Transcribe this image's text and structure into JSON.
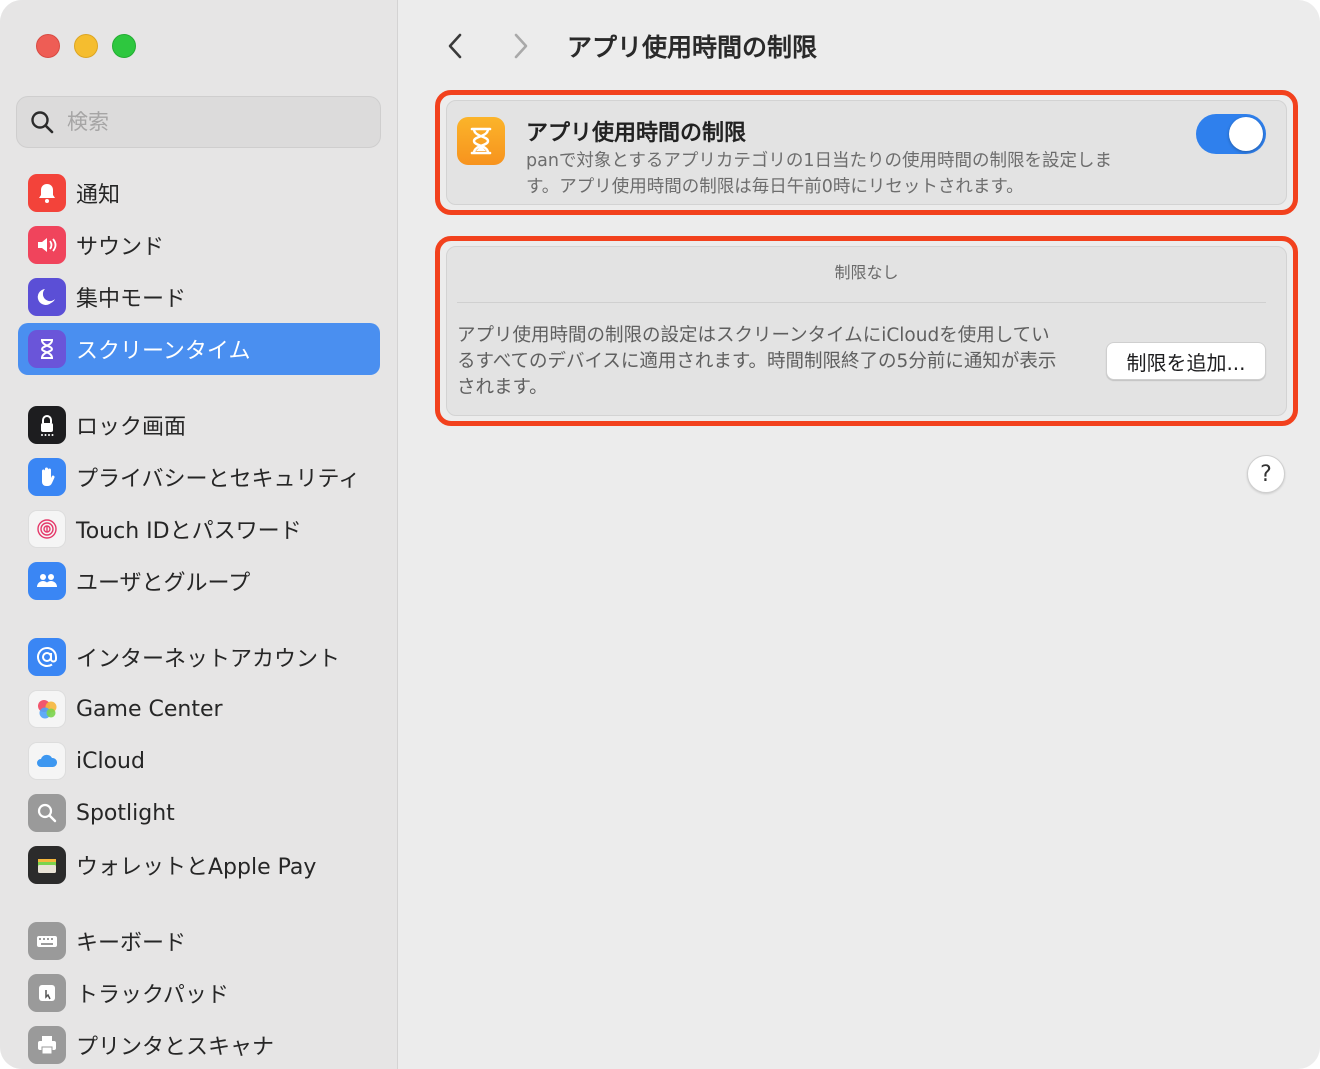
{
  "window": {
    "title": "アプリ使用時間の制限"
  },
  "search": {
    "placeholder": "検索"
  },
  "sidebar": {
    "items": [
      {
        "label": "通知",
        "icon": "bell-icon",
        "color": "#f3433a"
      },
      {
        "label": "サウンド",
        "icon": "speaker-icon",
        "color": "#f0445c"
      },
      {
        "label": "集中モード",
        "icon": "moon-icon",
        "color": "#5b4fd6"
      },
      {
        "label": "スクリーンタイム",
        "icon": "hourglass-icon",
        "color": "#6a55d9",
        "selected": true
      },
      {
        "label": "ロック画面",
        "icon": "lock-icon",
        "color": "#1d1d1f"
      },
      {
        "label": "プライバシーとセキュリティ",
        "icon": "hand-icon",
        "color": "#3a86f4"
      },
      {
        "label": "Touch IDとパスワード",
        "icon": "fingerprint-icon",
        "color": "#f5f5f5"
      },
      {
        "label": "ユーザとグループ",
        "icon": "users-icon",
        "color": "#3a86f4"
      },
      {
        "label": "インターネットアカウント",
        "icon": "at-icon",
        "color": "#3a86f4"
      },
      {
        "label": "Game Center",
        "icon": "game-center-icon",
        "color": "#f5f5f5"
      },
      {
        "label": "iCloud",
        "icon": "cloud-icon",
        "color": "#f5f5f5"
      },
      {
        "label": "Spotlight",
        "icon": "magnifier-icon",
        "color": "#9a9a9a"
      },
      {
        "label": "ウォレットとApple Pay",
        "icon": "wallet-icon",
        "color": "#2b2b2b"
      },
      {
        "label": "キーボード",
        "icon": "keyboard-icon",
        "color": "#9a9a9a"
      },
      {
        "label": "トラックパッド",
        "icon": "trackpad-icon",
        "color": "#9a9a9a"
      },
      {
        "label": "プリンタとスキャナ",
        "icon": "printer-icon",
        "color": "#9a9a9a"
      }
    ]
  },
  "limit_card": {
    "title": "アプリ使用時間の制限",
    "description": "panで対象とするアプリカテゴリの1日当たりの使用時間の制限を設定します。アプリ使用時間の制限は毎日午前0時にリセットされます。",
    "toggle_on": true,
    "icon": "hourglass-icon"
  },
  "limits_list": {
    "empty_label": "制限なし",
    "footer_text": "アプリ使用時間の制限の設定はスクリーンタイムにiCloudを使用しているすべてのデバイスに適用されます。時間制限終了の5分前に通知が表示されます。",
    "add_button": "制限を追加..."
  },
  "help_label": "?",
  "colors": {
    "accent": "#2f80ed",
    "selection": "#4a8ff0",
    "highlight_border": "#f2411d"
  }
}
